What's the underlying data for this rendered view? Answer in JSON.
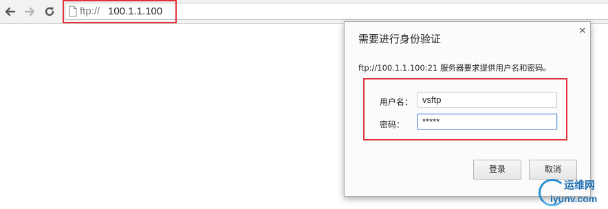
{
  "browser": {
    "back_icon": "arrow-left-icon",
    "forward_icon": "arrow-right-icon",
    "reload_icon": "reload-icon",
    "page_icon": "document-icon",
    "url_scheme": "ftp://",
    "url_host": "100.1.1.100"
  },
  "dialog": {
    "title": "需要进行身份验证",
    "close_icon": "close-icon",
    "message": "ftp://100.1.1.100:21 服务器要求提供用户名和密码。",
    "username_label": "用户名：",
    "username_value": "vsftp",
    "password_label": "密码：",
    "password_value": "*****",
    "login_label": "登录",
    "cancel_label": "取消"
  },
  "watermark": {
    "title": "运维网",
    "url": "iyunv.com"
  },
  "colors": {
    "highlight": "#e2323c",
    "focus": "#5b8fd6",
    "watermark": "#1f6fb0"
  }
}
